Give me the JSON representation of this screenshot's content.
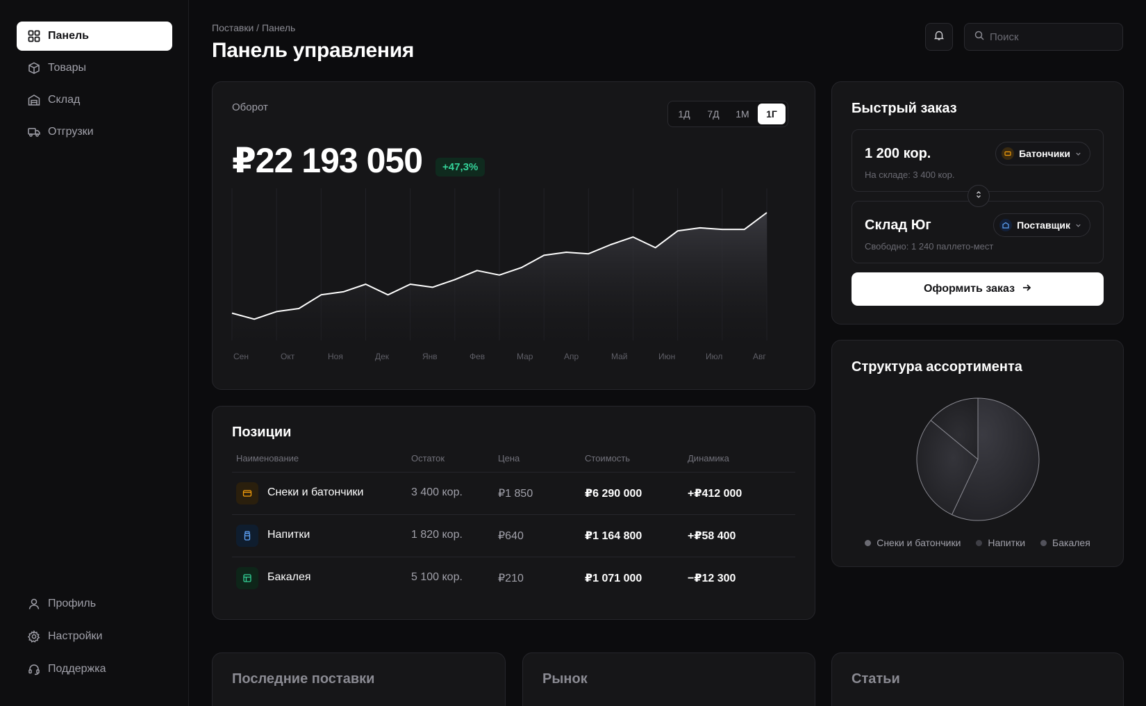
{
  "sidebar": {
    "items": [
      {
        "label": "Панель",
        "icon": "grid-icon",
        "active": true
      },
      {
        "label": "Товары",
        "icon": "box-icon"
      },
      {
        "label": "Склад",
        "icon": "warehouse-icon"
      },
      {
        "label": "Отгрузки",
        "icon": "truck-icon"
      }
    ],
    "bottom_items": [
      {
        "label": "Профиль",
        "icon": "user-icon"
      },
      {
        "label": "Настройки",
        "icon": "gear-icon"
      },
      {
        "label": "Поддержка",
        "icon": "headset-icon"
      }
    ]
  },
  "header": {
    "breadcrumb": "Поставки / Панель",
    "title": "Панель управления",
    "search_placeholder": "Поиск"
  },
  "turnover": {
    "label": "Оборот",
    "value": "₽22 193 050",
    "delta": "+47,3%",
    "ranges": [
      "1Д",
      "7Д",
      "1М",
      "1Г"
    ],
    "active_range": "1Г"
  },
  "chart_data": {
    "type": "area",
    "x": [
      "Сен",
      "Окт",
      "Ноя",
      "Дек",
      "Янв",
      "Фев",
      "Мар",
      "Апр",
      "Май",
      "Июн",
      "Июл",
      "Авг"
    ],
    "x_tick_labels": [
      "Сен",
      "Окт",
      "Ноя",
      "Дек",
      "Янв",
      "Фев",
      "Мар",
      "Апр",
      "Май",
      "Июн",
      "Июл",
      "Авг"
    ],
    "values": [
      0.18,
      0.14,
      0.19,
      0.21,
      0.3,
      0.32,
      0.37,
      0.3,
      0.37,
      0.35,
      0.4,
      0.46,
      0.43,
      0.48,
      0.56,
      0.58,
      0.57,
      0.63,
      0.68,
      0.61,
      0.72,
      0.74,
      0.73,
      0.73,
      0.84
    ],
    "values_note_scale": "relative 0-1 of plot height",
    "grid": true,
    "line_color": "#ffffff"
  },
  "positions": {
    "title": "Позиции",
    "columns": [
      "Наименование",
      "Остаток",
      "Цена",
      "Стоимость",
      "Динамика"
    ],
    "rows": [
      {
        "name": "Снеки и батончики",
        "stock": "3 400 кор.",
        "price": "₽1 850",
        "cost": "₽6 290 000",
        "dynamics": "+₽412 000",
        "icon": "snack-icon",
        "color": "#f59e0b"
      },
      {
        "name": "Напитки",
        "stock": "1 820 кор.",
        "price": "₽640",
        "cost": "₽1 164 800",
        "dynamics": "+₽58 400",
        "icon": "bottle-icon",
        "color": "#60a5fa"
      },
      {
        "name": "Бакалея",
        "stock": "5 100 кор.",
        "price": "₽210",
        "cost": "₽1 071 000",
        "dynamics": "−₽12 300",
        "icon": "grocery-icon",
        "color": "#34d399"
      }
    ]
  },
  "quick_order": {
    "title": "Быстрый заказ",
    "amount": "1 200 кор.",
    "amount_hint": "На складе: 3 400 кор.",
    "product_pill": "Батончики",
    "warehouse": "Склад Юг",
    "warehouse_hint": "Свободно: 1 240 паллето-мест",
    "supplier_pill": "Поставщик",
    "submit": "Оформить заказ"
  },
  "assortment": {
    "title": "Структура ассортимента",
    "chart": {
      "type": "pie",
      "labels": [
        "Снеки и батончики",
        "Напитки",
        "Бакалея"
      ],
      "values": [
        57,
        29,
        14
      ]
    }
  },
  "bottom_cards": {
    "recent": "Последние поставки",
    "market": "Рынок",
    "articles": "Статьи"
  },
  "colors": {
    "background": "#0c0c0e",
    "card": "#161618",
    "positive": "#34d399"
  }
}
